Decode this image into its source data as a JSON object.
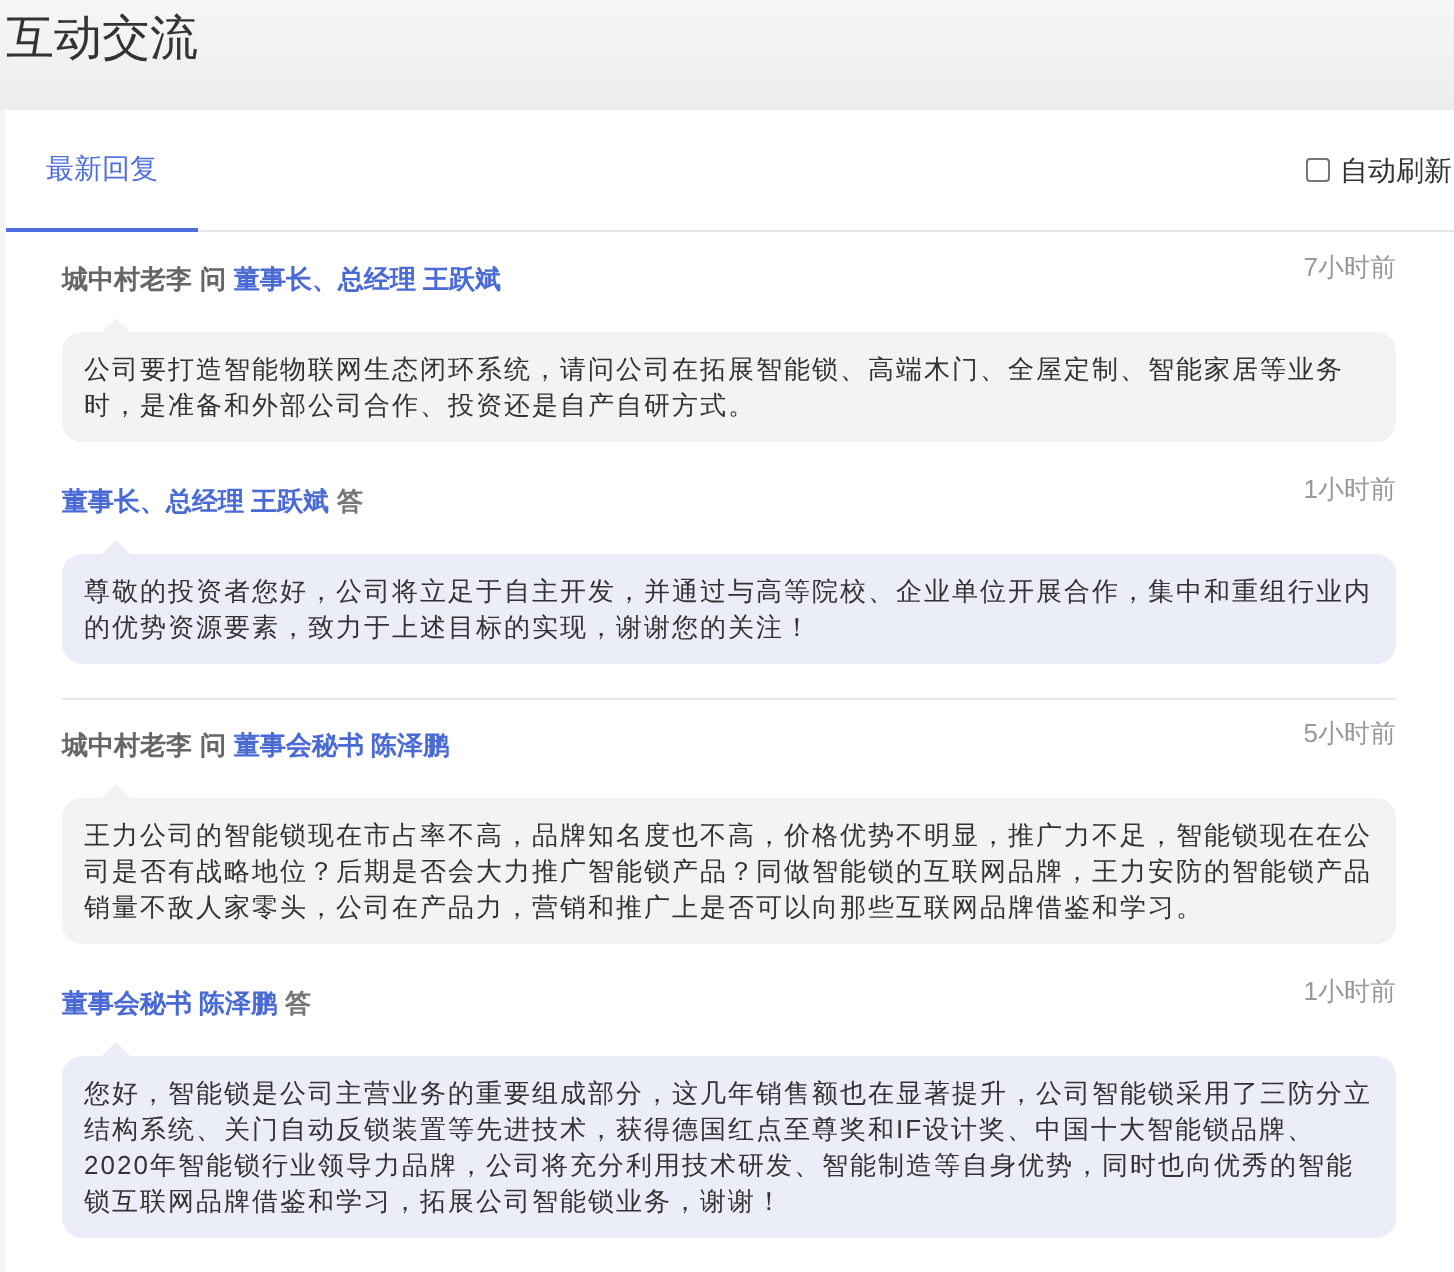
{
  "page": {
    "title": "互动交流"
  },
  "tabs": [
    {
      "label": "最新回复",
      "selected": true
    }
  ],
  "auto_refresh": {
    "label": "自动刷新",
    "checked": false
  },
  "threads": [
    {
      "question": {
        "asker": "城中村老李",
        "verb": "问",
        "addressee": "董事长、总经理 王跃斌",
        "time": "7小时前",
        "text": "公司要打造智能物联网生态闭环系统，请问公司在拓展智能锁、高端木门、全屋定制、智能家居等业务时，是准备和外部公司合作、投资还是自产自研方式。"
      },
      "answer": {
        "responder": "董事长、总经理 王跃斌",
        "verb": "答",
        "time": "1小时前",
        "text": "尊敬的投资者您好，公司将立足于自主开发，并通过与高等院校、企业单位开展合作，集中和重组行业内的优势资源要素，致力于上述目标的实现，谢谢您的关注！"
      }
    },
    {
      "question": {
        "asker": "城中村老李",
        "verb": "问",
        "addressee": "董事会秘书 陈泽鹏",
        "time": "5小时前",
        "text": "王力公司的智能锁现在市占率不高，品牌知名度也不高，价格优势不明显，推广力不足，智能锁现在在公司是否有战略地位？后期是否会大力推广智能锁产品？同做智能锁的互联网品牌，王力安防的智能锁产品销量不敌人家零头，公司在产品力，营销和推广上是否可以向那些互联网品牌借鉴和学习。"
      },
      "answer": {
        "responder": "董事会秘书 陈泽鹏",
        "verb": "答",
        "time": "1小时前",
        "text": "您好，智能锁是公司主营业务的重要组成部分，这几年销售额也在显著提升，公司智能锁采用了三防分立结构系统、关门自动反锁装置等先进技术，获得德国红点至尊奖和IF设计奖、中国十大智能锁品牌、2020年智能锁行业领导力品牌，公司将充分利用技术研发、智能制造等自身优势，同时也向优秀的智能锁互联网品牌借鉴和学习，拓展公司智能锁业务，谢谢！"
      }
    }
  ]
}
